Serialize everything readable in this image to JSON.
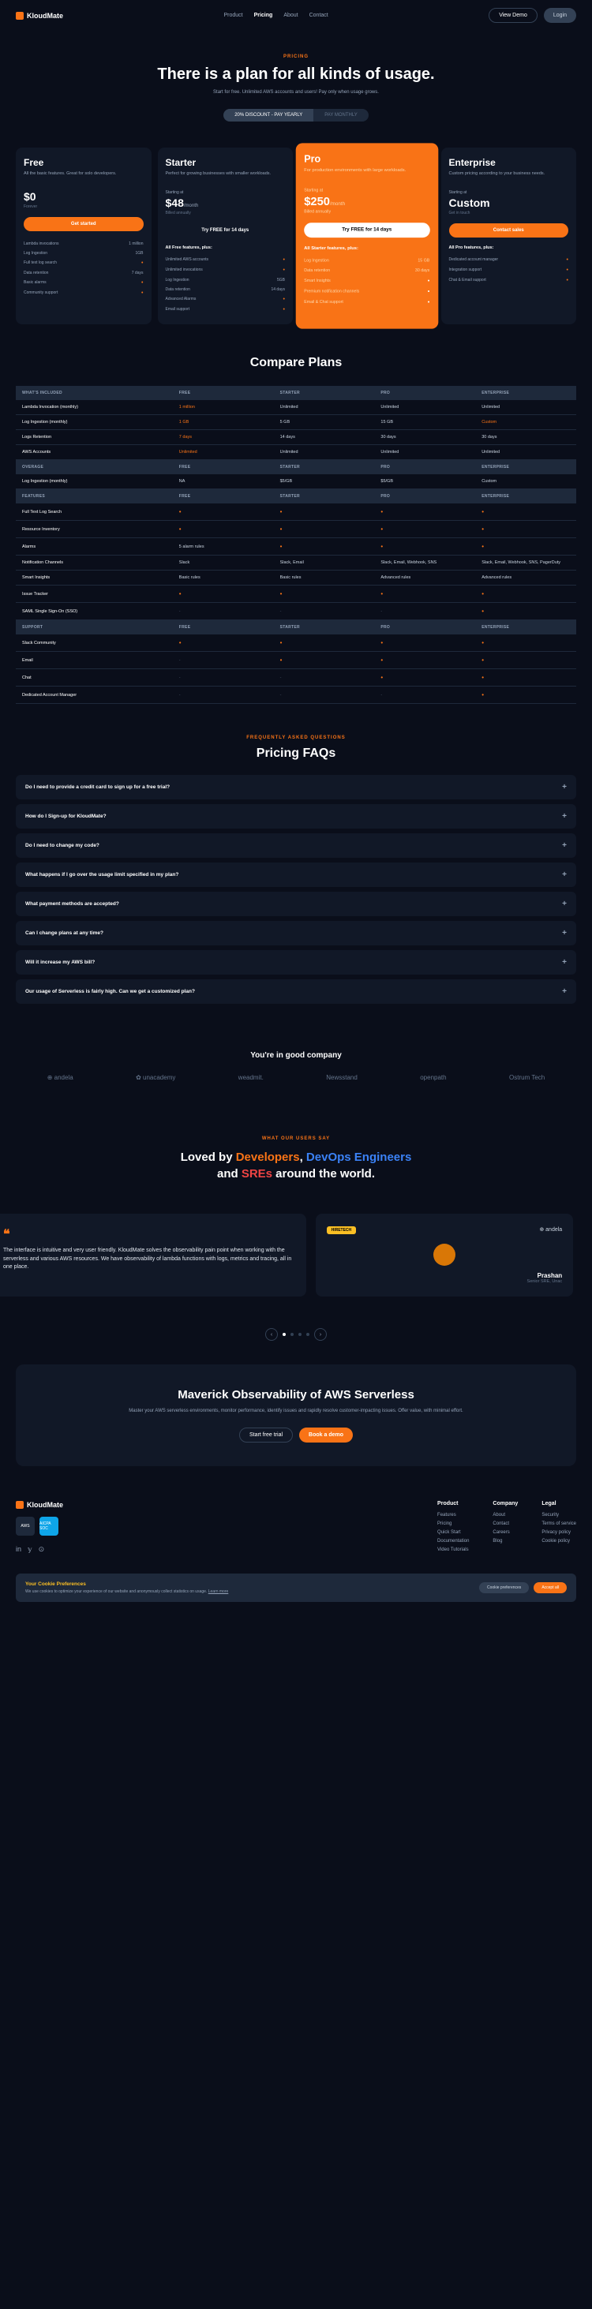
{
  "header": {
    "brand": "KloudMate",
    "nav": [
      "Product",
      "Pricing",
      "About",
      "Contact"
    ],
    "demo": "View Demo",
    "login": "Login"
  },
  "hero": {
    "eyebrow": "PRICING",
    "title": "There is a plan for all kinds of usage.",
    "sub": "Start for free. Unlimited AWS accounts and users! Pay only when usage grows."
  },
  "toggle": {
    "yearly": "20% DISCOUNT - PAY YEARLY",
    "monthly": "PAY MONTHLY"
  },
  "plans": [
    {
      "name": "Free",
      "desc": "All the basic features. Great for solo developers.",
      "start": "",
      "price": "$0",
      "per": "",
      "sub": "Forever",
      "cta": "Get started",
      "fh": "",
      "feats": [
        [
          "Lambda invocations",
          "1 million"
        ],
        [
          "Log Ingestion",
          "1GB"
        ],
        [
          "Full text log search",
          "•"
        ],
        [
          "Data retention",
          "7 days"
        ],
        [
          "Basic alarms",
          "•"
        ],
        [
          "Community support",
          "•"
        ]
      ]
    },
    {
      "name": "Starter",
      "desc": "Perfect for growing businesses with smaller workloads.",
      "start": "Starting at",
      "price": "$48",
      "per": "/month",
      "sub": "Billed annually",
      "cta": "Try FREE for 14 days",
      "fh": "All Free features, plus:",
      "feats": [
        [
          "Unlimited AWS accounts",
          "•"
        ],
        [
          "Unlimited invocations",
          "•"
        ],
        [
          "Log Ingestion",
          "5GB"
        ],
        [
          "Data retention",
          "14 days"
        ],
        [
          "Advanced Alarms",
          "•"
        ],
        [
          "Email support",
          "•"
        ]
      ]
    },
    {
      "name": "Pro",
      "desc": "For production environments with large workloads.",
      "start": "Starting at",
      "price": "$250",
      "per": "/month",
      "sub": "Billed annually",
      "cta": "Try FREE for 14 days",
      "fh": "All Starter features, plus:",
      "feats": [
        [
          "Log Ingestion",
          "15 GB"
        ],
        [
          "Data retention",
          "30 days"
        ],
        [
          "Smart Insights",
          "•"
        ],
        [
          "Premium notification channels",
          "•"
        ],
        [
          "Email & Chat support",
          "•"
        ]
      ]
    },
    {
      "name": "Enterprise",
      "desc": "Custom pricing according to your business needs.",
      "start": "Starting at",
      "price": "Custom",
      "per": "",
      "sub": "Get in touch",
      "cta": "Contact sales",
      "fh": "All Pro features, plus:",
      "feats": [
        [
          "Dedicated account manager",
          "•"
        ],
        [
          "Integration support",
          "•"
        ],
        [
          "Chat & Email support",
          "•"
        ]
      ]
    }
  ],
  "compare": {
    "title": "Compare Plans",
    "sections": [
      {
        "head": [
          "WHAT'S INCLUDED",
          "FREE",
          "STARTER",
          "PRO",
          "ENTERPRISE"
        ],
        "rows": [
          [
            "Lambda Invocation (monthly)",
            "1 million",
            "Unlimited",
            "Unlimited",
            "Unlimited"
          ],
          [
            "Log Ingestion (monthly)",
            "1 GB",
            "5 GB",
            "15 GB",
            "Custom"
          ],
          [
            "Logs Retention",
            "7 days",
            "14 days",
            "30 days",
            "30 days"
          ],
          [
            "AWS Accounts",
            "Unlimited",
            "Unlimited",
            "Unlimited",
            "Unlimited"
          ]
        ]
      },
      {
        "head": [
          "OVERAGE",
          "FREE",
          "STARTER",
          "PRO",
          "ENTERPRISE"
        ],
        "rows": [
          [
            "Log Ingestion (monthly)",
            "NA",
            "$5/GB",
            "$5/GB",
            "Custom"
          ]
        ]
      },
      {
        "head": [
          "FEATURES",
          "FREE",
          "STARTER",
          "PRO",
          "ENTERPRISE"
        ],
        "rows": [
          [
            "Full Text Log Search",
            "•",
            "•",
            "•",
            "•"
          ],
          [
            "Resource Inventory",
            "•",
            "•",
            "•",
            "•"
          ],
          [
            "Alarms",
            "5 alarm rules",
            "•",
            "•",
            "•"
          ],
          [
            "Notification Channels",
            "Slack",
            "Slack, Email",
            "Slack, Email, Webhook, SNS",
            "Slack, Email, Webhook, SNS, PagerDuty"
          ],
          [
            "Smart Insights",
            "Basic rules",
            "Basic rules",
            "Advanced rules",
            "Advanced rules"
          ],
          [
            "Issue Tracker",
            "•",
            "•",
            "•",
            "•"
          ],
          [
            "SAML Single Sign-On (SSO)",
            "-",
            "-",
            "-",
            "•"
          ]
        ]
      },
      {
        "head": [
          "SUPPORT",
          "FREE",
          "STARTER",
          "PRO",
          "ENTERPRISE"
        ],
        "rows": [
          [
            "Slack Community",
            "•",
            "•",
            "•",
            "•"
          ],
          [
            "Email",
            "-",
            "•",
            "•",
            "•"
          ],
          [
            "Chat",
            "-",
            "-",
            "•",
            "•"
          ],
          [
            "Dedicated Account Manager",
            "-",
            "-",
            "-",
            "•"
          ]
        ]
      }
    ]
  },
  "faqs": {
    "eyebrow": "FREQUENTLY ASKED QUESTIONS",
    "title": "Pricing FAQs",
    "items": [
      "Do I need to provide a credit card to sign up for a free trial?",
      "How do I Sign-up for KloudMate?",
      "Do I need to change my code?",
      "What happens if I go over the usage limit specified in my plan?",
      "What payment methods are accepted?",
      "Can I change plans at any time?",
      "Will it increase my AWS bill?",
      "Our usage of Serverless is fairly high. Can we get a customized plan?"
    ]
  },
  "company": {
    "title": "You're in good company",
    "logos": [
      "⊕ andela",
      "✿ unacademy",
      "weadmit.",
      "Newsstand",
      "openpath",
      "Ostrum Tech"
    ]
  },
  "loved": {
    "eyebrow": "WHAT OUR USERS SAY",
    "l1": "Loved by ",
    "l2": "Developers",
    "l3": ", ",
    "l4": "DevOps Engineers",
    "l5": "and ",
    "l6": "SREs",
    "l7": " around the world."
  },
  "testimonial": {
    "quote": "The interface is intuitive and very user friendly. KloudMate solves the observability pain point when working with the serverless and various AWS resources. We have observability of lambda functions with logs, metrics and tracing, all in one place.",
    "badge": "HIRETECH",
    "clogo": "⊕ andela",
    "name": "Prashan",
    "role": "Senior SRE, Unac"
  },
  "maverick": {
    "title": "Maverick Observability of AWS Serverless",
    "sub": "Master your AWS serverless environments, monitor performance, identify issues and rapidly resolve customer-impacting issues. Offer value, with minimal effort.",
    "b1": "Start free trial",
    "b2": "Book a demo"
  },
  "footer": {
    "cols": [
      {
        "h": "Product",
        "links": [
          "Features",
          "Pricing",
          "Quick Start",
          "Documentation",
          "Video Tutorials"
        ]
      },
      {
        "h": "Company",
        "links": [
          "About",
          "Contact",
          "Careers",
          "Blog"
        ]
      },
      {
        "h": "Legal",
        "links": [
          "Security",
          "Terms of service",
          "Privacy policy",
          "Cookie policy"
        ]
      }
    ]
  },
  "cookie": {
    "title": "Your Cookie Preferences",
    "text": "We use cookies to optimize your experience of our website and anonymously collect statistics on usage.",
    "more": "Learn more",
    "b1": "Cookie preferences",
    "b2": "Accept all"
  }
}
